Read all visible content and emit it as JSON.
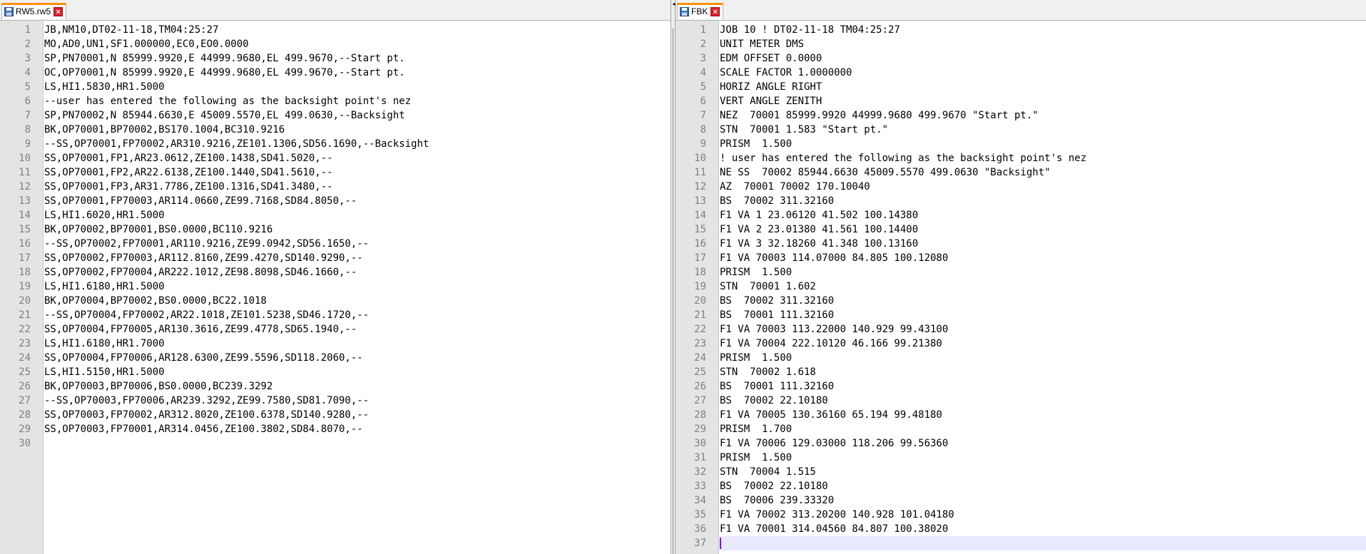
{
  "left": {
    "tab_label": "RW5.rw5",
    "lines": [
      {
        "n": "1",
        "text": "JB,NM10,DT02-11-18,TM04:25:27"
      },
      {
        "n": "2",
        "text": "MO,AD0,UN1,SF1.000000,EC0,EO0.0000"
      },
      {
        "n": "3",
        "text": "SP,PN70001,N 85999.9920,E 44999.9680,EL 499.9670,--Start pt."
      },
      {
        "n": "4",
        "text": "OC,OP70001,N 85999.9920,E 44999.9680,EL 499.9670,--Start pt."
      },
      {
        "n": "5",
        "text": "LS,HI1.5830,HR1.5000"
      },
      {
        "n": "6",
        "text": "--user has entered the following as the backsight point's nez"
      },
      {
        "n": "7",
        "text": "SP,PN70002,N 85944.6630,E 45009.5570,EL 499.0630,--Backsight"
      },
      {
        "n": "8",
        "text": "BK,OP70001,BP70002,BS170.1004,BC310.9216"
      },
      {
        "n": "9",
        "text": "--SS,OP70001,FP70002,AR310.9216,ZE101.1306,SD56.1690,--Backsight"
      },
      {
        "n": "10",
        "text": "SS,OP70001,FP1,AR23.0612,ZE100.1438,SD41.5020,--"
      },
      {
        "n": "11",
        "text": "SS,OP70001,FP2,AR22.6138,ZE100.1440,SD41.5610,--"
      },
      {
        "n": "12",
        "text": "SS,OP70001,FP3,AR31.7786,ZE100.1316,SD41.3480,--"
      },
      {
        "n": "13",
        "text": "SS,OP70001,FP70003,AR114.0660,ZE99.7168,SD84.8050,--"
      },
      {
        "n": "14",
        "text": "LS,HI1.6020,HR1.5000"
      },
      {
        "n": "15",
        "text": "BK,OP70002,BP70001,BS0.0000,BC110.9216"
      },
      {
        "n": "16",
        "text": "--SS,OP70002,FP70001,AR110.9216,ZE99.0942,SD56.1650,--"
      },
      {
        "n": "17",
        "text": "SS,OP70002,FP70003,AR112.8160,ZE99.4270,SD140.9290,--"
      },
      {
        "n": "18",
        "text": "SS,OP70002,FP70004,AR222.1012,ZE98.8098,SD46.1660,--"
      },
      {
        "n": "19",
        "text": "LS,HI1.6180,HR1.5000"
      },
      {
        "n": "20",
        "text": "BK,OP70004,BP70002,BS0.0000,BC22.1018"
      },
      {
        "n": "21",
        "text": "--SS,OP70004,FP70002,AR22.1018,ZE101.5238,SD46.1720,--"
      },
      {
        "n": "22",
        "text": "SS,OP70004,FP70005,AR130.3616,ZE99.4778,SD65.1940,--"
      },
      {
        "n": "23",
        "text": "LS,HI1.6180,HR1.7000"
      },
      {
        "n": "24",
        "text": "SS,OP70004,FP70006,AR128.6300,ZE99.5596,SD118.2060,--"
      },
      {
        "n": "25",
        "text": "LS,HI1.5150,HR1.5000"
      },
      {
        "n": "26",
        "text": "BK,OP70003,BP70006,BS0.0000,BC239.3292"
      },
      {
        "n": "27",
        "text": "--SS,OP70003,FP70006,AR239.3292,ZE99.7580,SD81.7090,--"
      },
      {
        "n": "28",
        "text": "SS,OP70003,FP70002,AR312.8020,ZE100.6378,SD140.9280,--"
      },
      {
        "n": "29",
        "text": "SS,OP70003,FP70001,AR314.0456,ZE100.3802,SD84.8070,--"
      },
      {
        "n": "30",
        "text": ""
      }
    ]
  },
  "right": {
    "tab_label": "FBK",
    "lines": [
      {
        "n": "1",
        "text": "JOB 10 ! DT02-11-18 TM04:25:27"
      },
      {
        "n": "2",
        "text": "UNIT METER DMS"
      },
      {
        "n": "3",
        "text": "EDM OFFSET 0.0000"
      },
      {
        "n": "4",
        "text": "SCALE FACTOR 1.0000000"
      },
      {
        "n": "5",
        "text": "HORIZ ANGLE RIGHT"
      },
      {
        "n": "6",
        "text": "VERT ANGLE ZENITH"
      },
      {
        "n": "7",
        "text": "NEZ  70001 85999.9920 44999.9680 499.9670 \"Start pt.\""
      },
      {
        "n": "8",
        "text": "STN  70001 1.583 \"Start pt.\""
      },
      {
        "n": "9",
        "text": "PRISM  1.500"
      },
      {
        "n": "10",
        "text": "! user has entered the following as the backsight point's nez"
      },
      {
        "n": "11",
        "text": "NE SS  70002 85944.6630 45009.5570 499.0630 \"Backsight\""
      },
      {
        "n": "12",
        "text": "AZ  70001 70002 170.10040"
      },
      {
        "n": "13",
        "text": "BS  70002 311.32160"
      },
      {
        "n": "14",
        "text": "F1 VA 1 23.06120 41.502 100.14380"
      },
      {
        "n": "15",
        "text": "F1 VA 2 23.01380 41.561 100.14400"
      },
      {
        "n": "16",
        "text": "F1 VA 3 32.18260 41.348 100.13160"
      },
      {
        "n": "17",
        "text": "F1 VA 70003 114.07000 84.805 100.12080"
      },
      {
        "n": "18",
        "text": "PRISM  1.500"
      },
      {
        "n": "19",
        "text": "STN  70001 1.602"
      },
      {
        "n": "20",
        "text": "BS  70002 311.32160"
      },
      {
        "n": "21",
        "text": "BS  70001 111.32160"
      },
      {
        "n": "22",
        "text": "F1 VA 70003 113.22000 140.929 99.43100"
      },
      {
        "n": "23",
        "text": "F1 VA 70004 222.10120 46.166 99.21380"
      },
      {
        "n": "24",
        "text": "PRISM  1.500"
      },
      {
        "n": "25",
        "text": "STN  70002 1.618"
      },
      {
        "n": "26",
        "text": "BS  70001 111.32160"
      },
      {
        "n": "27",
        "text": "BS  70002 22.10180"
      },
      {
        "n": "28",
        "text": "F1 VA 70005 130.36160 65.194 99.48180"
      },
      {
        "n": "29",
        "text": "PRISM  1.700"
      },
      {
        "n": "30",
        "text": "F1 VA 70006 129.03000 118.206 99.56360"
      },
      {
        "n": "31",
        "text": "PRISM  1.500"
      },
      {
        "n": "32",
        "text": "STN  70004 1.515"
      },
      {
        "n": "33",
        "text": "BS  70002 22.10180"
      },
      {
        "n": "34",
        "text": "BS  70006 239.33320"
      },
      {
        "n": "35",
        "text": "F1 VA 70002 313.20200 140.928 101.04180"
      },
      {
        "n": "36",
        "text": "F1 VA 70001 314.04560 84.807 100.38020"
      },
      {
        "n": "37",
        "text": ""
      }
    ]
  },
  "icons": {
    "tab_icon": "floppy-disk-icon",
    "close_icon": "close-icon",
    "close_glyph": "×",
    "splitter_arrow": "◂"
  },
  "colors": {
    "current_line": "#e8e8ff",
    "gutter": "#e4e4e4",
    "line_number": "#808080",
    "tab_accent": "#fa8f11",
    "close_button": "#dc1f26",
    "caret": "#8000ff"
  }
}
